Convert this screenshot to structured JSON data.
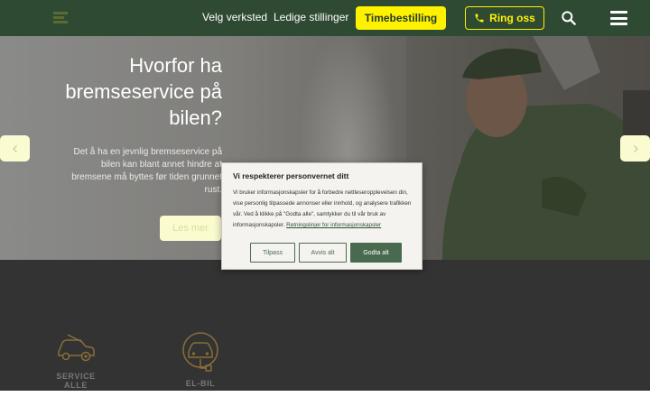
{
  "header": {
    "nav": [
      "Velg verksted",
      "Ledige stillinger"
    ],
    "booking_label": "Timebestilling",
    "ring_label": "Ring oss"
  },
  "hero": {
    "title": "Hvorfor ha bremseservice på bilen?",
    "text": "Det å ha en jevnlig bremseservice på bilen kan blant annet hindre at bremsene må byttes før tiden grunnet rust.",
    "button_label": "Les mer"
  },
  "services": [
    {
      "label": "SERVICE ALLE",
      "icon": "car-service-icon"
    },
    {
      "label": "EL-BIL",
      "icon": "ev-car-icon"
    }
  ],
  "cookie": {
    "title": "Vi respekterer personvernet ditt",
    "body": "Vi bruker informasjonskapsler for å forbedre nettleseropplevelsen din, vise personlig tilpassede annonser eller innhold, og analysere trafikken vår. Ved å klikke på \"Godta alle\", samtykker du til vår bruk av informasjonskapsler.",
    "link": "Retningslinjer for informasjonskapsler",
    "buttons": {
      "customize": "Tilpass",
      "reject": "Avvis alt",
      "accept": "Godta alt"
    }
  },
  "colors": {
    "header_bg": "#2f4a33",
    "accent_yellow": "#fff200",
    "dark_section": "#333333",
    "accept_button": "#4a6a4f"
  }
}
